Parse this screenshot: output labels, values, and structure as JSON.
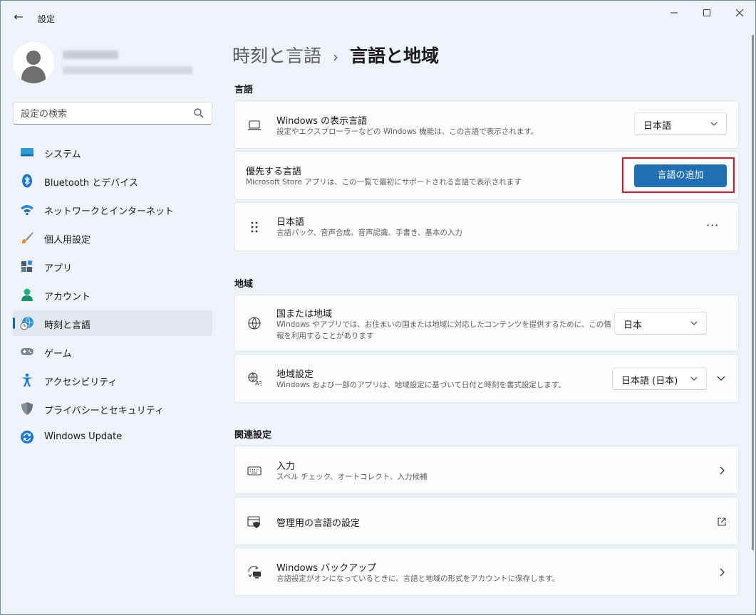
{
  "window": {
    "title": "設定"
  },
  "search": {
    "placeholder": "設定の検索"
  },
  "nav": [
    {
      "label": "システム",
      "icon": "system-icon"
    },
    {
      "label": "Bluetooth とデバイス",
      "icon": "bluetooth-icon"
    },
    {
      "label": "ネットワークとインターネット",
      "icon": "wifi-icon"
    },
    {
      "label": "個人用設定",
      "icon": "brush-icon"
    },
    {
      "label": "アプリ",
      "icon": "apps-icon"
    },
    {
      "label": "アカウント",
      "icon": "account-icon"
    },
    {
      "label": "時刻と言語",
      "icon": "time-language-icon",
      "selected": true
    },
    {
      "label": "ゲーム",
      "icon": "gamepad-icon"
    },
    {
      "label": "アクセシビリティ",
      "icon": "accessibility-icon"
    },
    {
      "label": "プライバシーとセキュリティ",
      "icon": "shield-icon"
    },
    {
      "label": "Windows Update",
      "icon": "update-icon"
    }
  ],
  "breadcrumb": {
    "parent": "時刻と言語",
    "separator": "›",
    "current": "言語と地域"
  },
  "sections": {
    "language": "言語",
    "region": "地域",
    "related": "関連設定"
  },
  "language": {
    "display": {
      "title": "Windows の表示言語",
      "subtitle": "設定やエクスプローラーなどの Windows 機能は、この言語で表示されます。",
      "value": "日本語"
    },
    "preferred": {
      "title": "優先する言語",
      "subtitle": "Microsoft Store アプリは、この一覧で最初にサポートされる言語で表示されます",
      "button": "言語の追加"
    },
    "item": {
      "title": "日本語",
      "subtitle": "言語パック、音声合成、音声認識、手書き、基本の入力",
      "more": "···"
    }
  },
  "region": {
    "country": {
      "title": "国または地域",
      "subtitle1": "Windows やアプリでは、お住まいの国または地域に対応したコンテンツを提供するために、この情",
      "subtitle2": "報を利用することがあります",
      "value": "日本"
    },
    "format": {
      "title": "地域設定",
      "subtitle": "Windows および一部のアプリは、地域設定に基づいて日付と時刻を書式設定します。",
      "value": "日本語 (日本)"
    }
  },
  "related": [
    {
      "title": "入力",
      "subtitle": "スペル チェック、オートコレクト、入力候補",
      "icon": "keyboard-icon"
    },
    {
      "title": "管理用の言語の設定",
      "subtitle": "",
      "icon": "admin-language-icon"
    },
    {
      "title": "Windows バックアップ",
      "subtitle": "言語設定がオンになっているときに、言語と地域の形式をアカウントに保存します。",
      "icon": "backup-icon"
    }
  ],
  "colors": {
    "accent": "#1f6fb2",
    "highlight": "#e0141e",
    "background": "#eef3f9"
  }
}
